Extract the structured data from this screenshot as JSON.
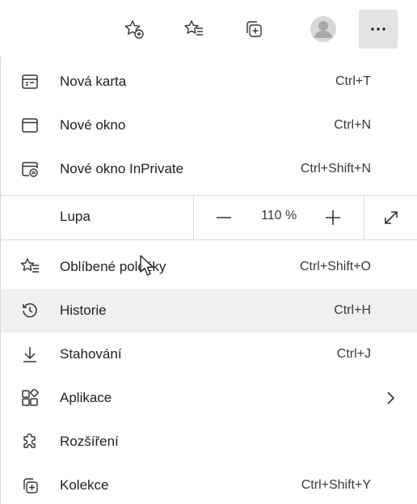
{
  "toolbar": {
    "buttons": [
      {
        "name": "add-favorite-icon"
      },
      {
        "name": "favorites-icon"
      },
      {
        "name": "collections-icon"
      },
      {
        "name": "profile-avatar"
      },
      {
        "name": "settings-and-more-icon",
        "label": "..."
      }
    ]
  },
  "menu": {
    "new_tab": {
      "label": "Nová karta",
      "shortcut": "Ctrl+T"
    },
    "new_window": {
      "label": "Nové okno",
      "shortcut": "Ctrl+N"
    },
    "new_inprivate": {
      "label": "Nové okno InPrivate",
      "shortcut": "Ctrl+Shift+N"
    },
    "zoom": {
      "label": "Lupa",
      "value": "110 %"
    },
    "favorites": {
      "label": "Oblíbené položky",
      "shortcut": "Ctrl+Shift+O"
    },
    "history": {
      "label": "Historie",
      "shortcut": "Ctrl+H"
    },
    "downloads": {
      "label": "Stahování",
      "shortcut": "Ctrl+J"
    },
    "apps": {
      "label": "Aplikace"
    },
    "extensions": {
      "label": "Rozšíření"
    },
    "collections": {
      "label": "Kolekce",
      "shortcut": "Ctrl+Shift+Y"
    }
  },
  "colors": {
    "hover_bg": "#f0f0f0",
    "active_button_bg": "#e3e3e3",
    "separator": "#dcdcdc"
  }
}
